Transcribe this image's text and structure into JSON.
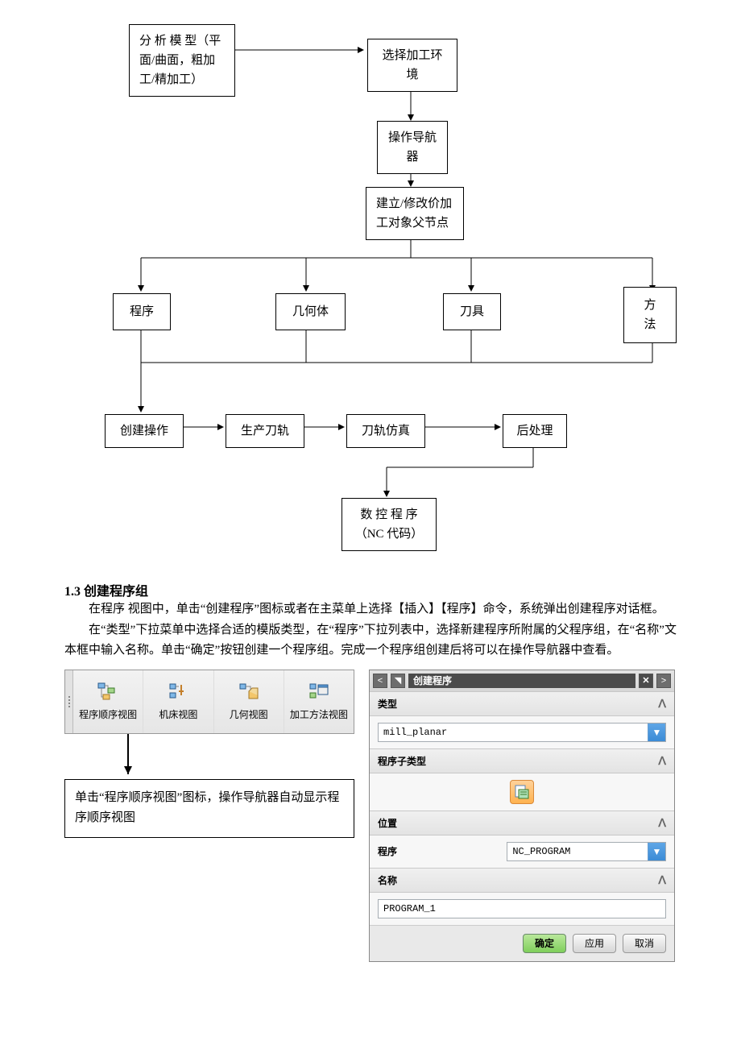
{
  "flowchart": {
    "analyze": "分 析 模 型（平面/曲面，粗加工/精加工）",
    "select_env": "选择加工环境",
    "op_nav": "操作导航器",
    "build_parent": "建立/修改价加工对象父节点",
    "program": "程序",
    "geometry": "几何体",
    "tool": "刀具",
    "method": "方法",
    "create_op": "创建操作",
    "gen_path": "生产刀轨",
    "simulate": "刀轨仿真",
    "postproc": "后处理",
    "nc_code": "数 控 程 序（NC 代码）"
  },
  "section": {
    "title": "1.3 创建程序组",
    "p1": "在程序 视图中，单击“创建程序”图标或者在主菜单上选择【插入】【程序】命令，系统弹出创建程序对话框。",
    "p2": "在“类型”下拉菜单中选择合适的模版类型，在“程序”下拉列表中，选择新建程序所附属的父程序组，在“名称”文本框中输入名称。单击“确定”按钮创建一个程序组。完成一个程序组创建后将可以在操作导航器中查看。"
  },
  "toolbar": {
    "btn1": "程序顺序视图",
    "btn2": "机床视图",
    "btn3": "几何视图",
    "btn4": "加工方法视图"
  },
  "annotation": "单击“程序顺序视图”图标，操作导航器自动显示程序顺序视图",
  "panel": {
    "title": "创建程序",
    "sections": {
      "type": "类型",
      "subtype": "程序子类型",
      "location": "位置",
      "name": "名称"
    },
    "type_value": "mill_planar",
    "location_label": "程序",
    "location_value": "NC_PROGRAM",
    "name_value": "PROGRAM_1",
    "buttons": {
      "ok": "确定",
      "apply": "应用",
      "cancel": "取消"
    }
  }
}
